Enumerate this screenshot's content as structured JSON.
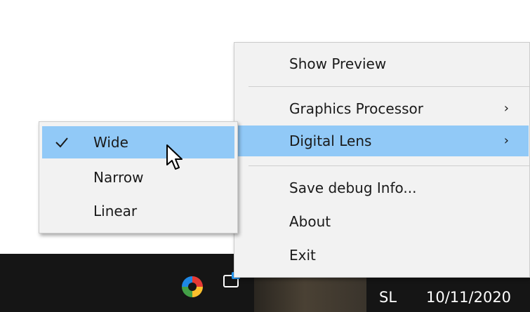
{
  "main_menu": {
    "items": [
      {
        "label": "Show Preview"
      },
      {
        "label": "Graphics Processor",
        "arrow": "›"
      },
      {
        "label": "Digital Lens",
        "arrow": "›"
      },
      {
        "label": "Save debug Info..."
      },
      {
        "label": "About"
      },
      {
        "label": "Exit"
      }
    ]
  },
  "sub_menu": {
    "items": [
      {
        "label": "Wide",
        "checked": true
      },
      {
        "label": "Narrow"
      },
      {
        "label": "Linear"
      }
    ]
  },
  "taskbar": {
    "language": "SL",
    "date": "10/11/2020"
  },
  "colors": {
    "highlight": "#91c9f7",
    "menu_bg": "#f2f2f2",
    "taskbar_bg": "#151515"
  },
  "icons": [
    "checkmark-icon",
    "chevron-right-icon",
    "mouse-cursor-icon",
    "tray-app-icon",
    "tray-window-icon"
  ]
}
